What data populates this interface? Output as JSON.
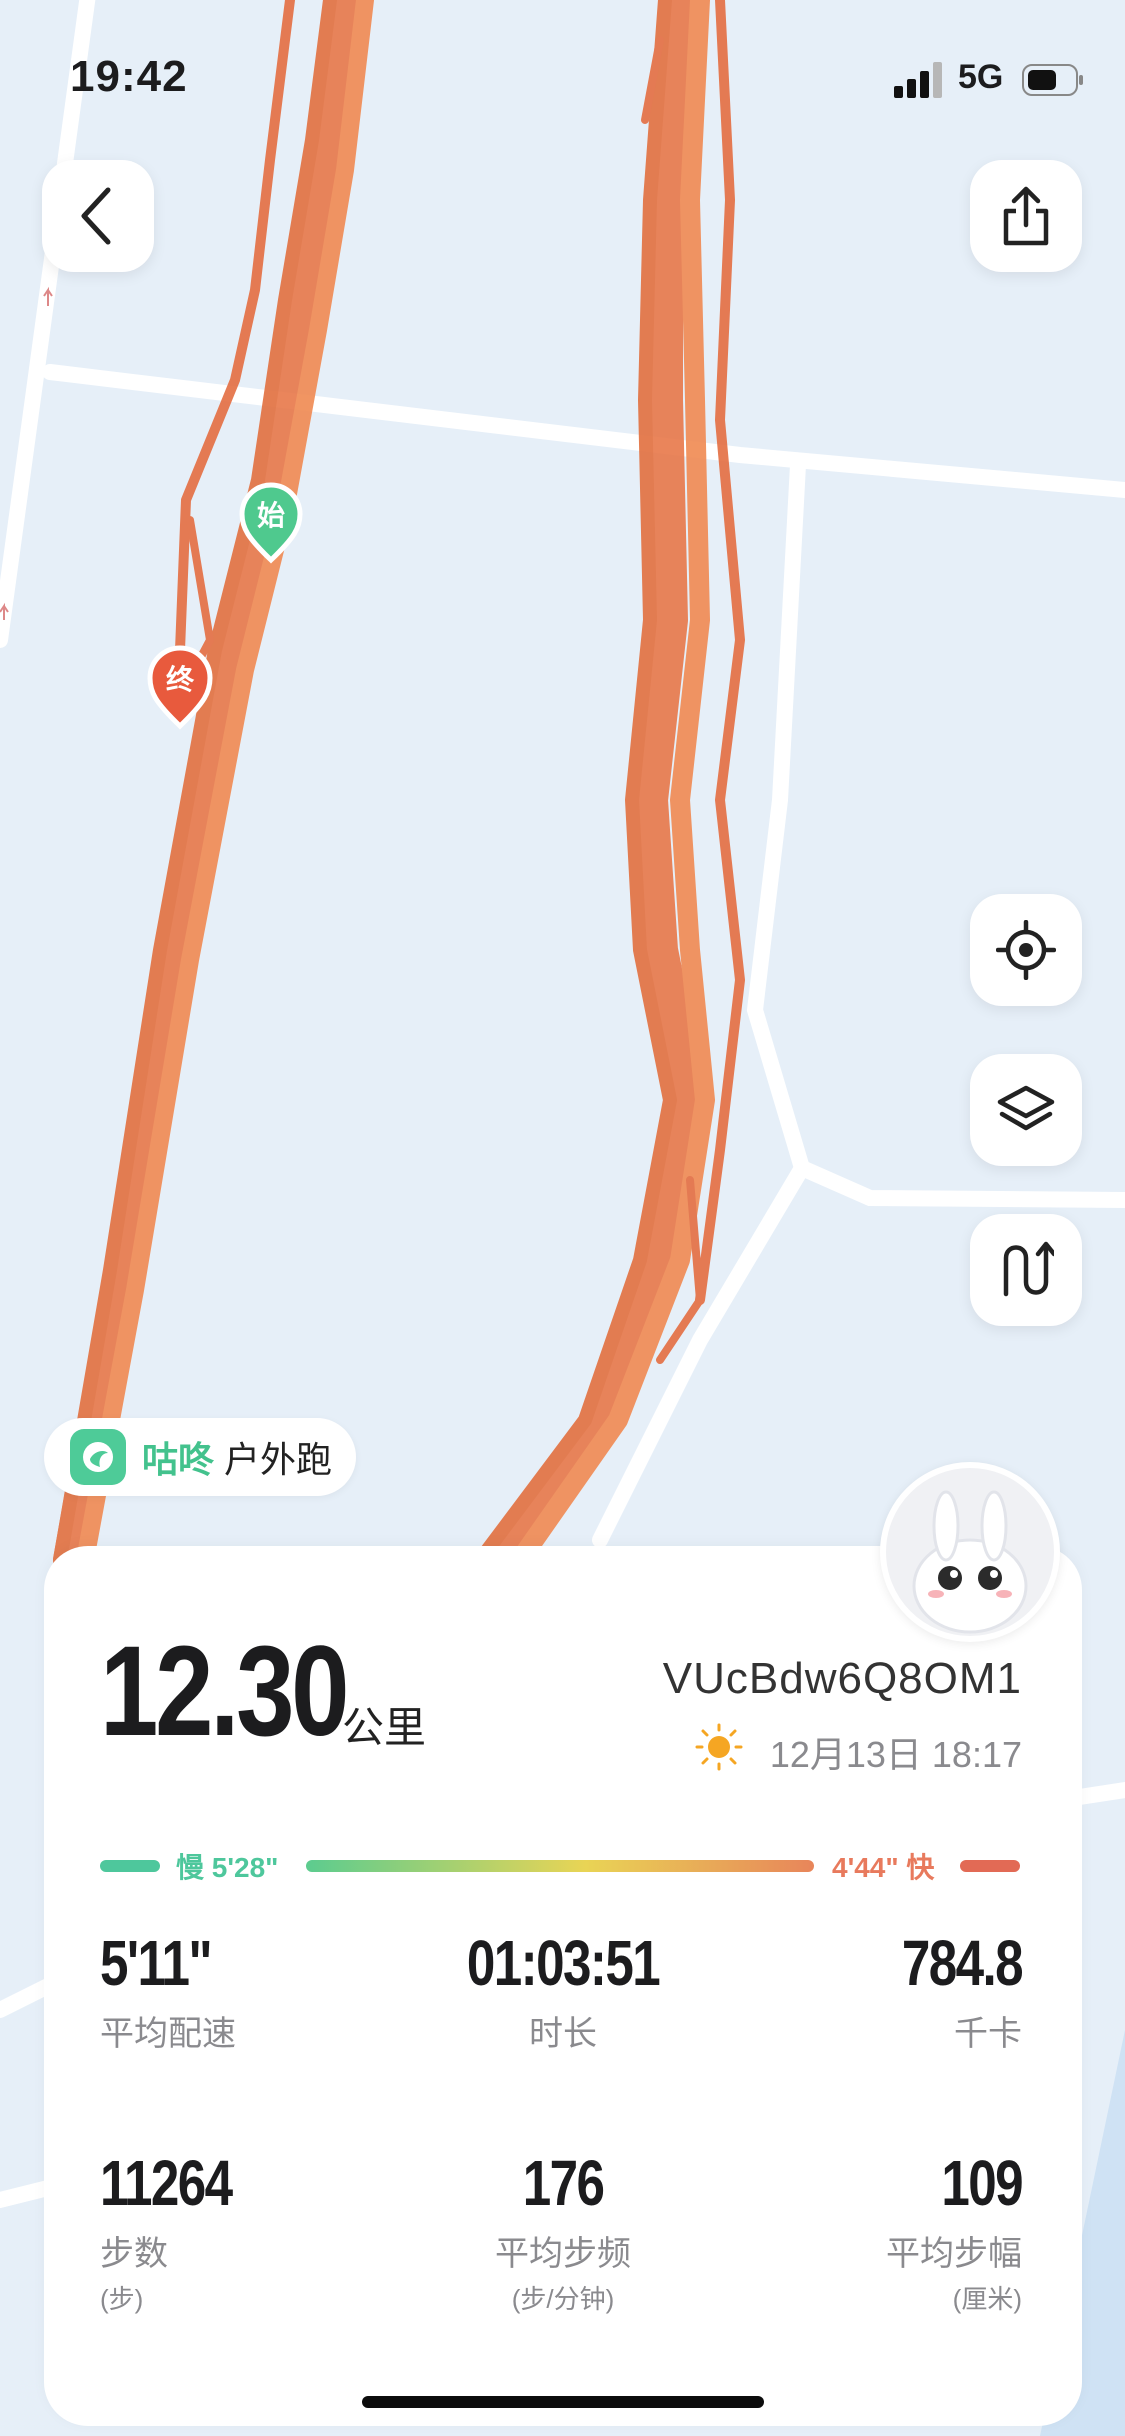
{
  "status_bar": {
    "time": "19:42",
    "network": "5G"
  },
  "map": {
    "start_marker": "始",
    "end_marker": "终",
    "route_color": "#e8784a"
  },
  "toolbar": {
    "back_icon": "chevron-left-icon",
    "share_icon": "share-icon",
    "locate_icon": "locate-icon",
    "layers_icon": "layers-icon",
    "route_icon": "route-icon"
  },
  "activity_tag": {
    "brand": "咕咚",
    "type": "户外跑"
  },
  "summary": {
    "distance": "12.30",
    "distance_unit": "公里",
    "record_id": "VUcBdw6Q8OM1",
    "datetime": "12月13日 18:17",
    "weather_icon": "sun-icon"
  },
  "pace_legend": {
    "slow": "慢 5'28\"",
    "fast": "4'44\" 快",
    "slow_color": "#4ec79c",
    "fast_color": "#e26a55"
  },
  "stats": [
    {
      "value": "5'11\"",
      "label": "平均配速",
      "sub": ""
    },
    {
      "value": "01:03:51",
      "label": "时长",
      "sub": ""
    },
    {
      "value": "784.8",
      "label": "千卡",
      "sub": ""
    },
    {
      "value": "11264",
      "label": "步数",
      "sub": "(步)"
    },
    {
      "value": "176",
      "label": "平均步频",
      "sub": "(步/分钟)"
    },
    {
      "value": "109",
      "label": "平均步幅",
      "sub": "(厘米)"
    }
  ]
}
